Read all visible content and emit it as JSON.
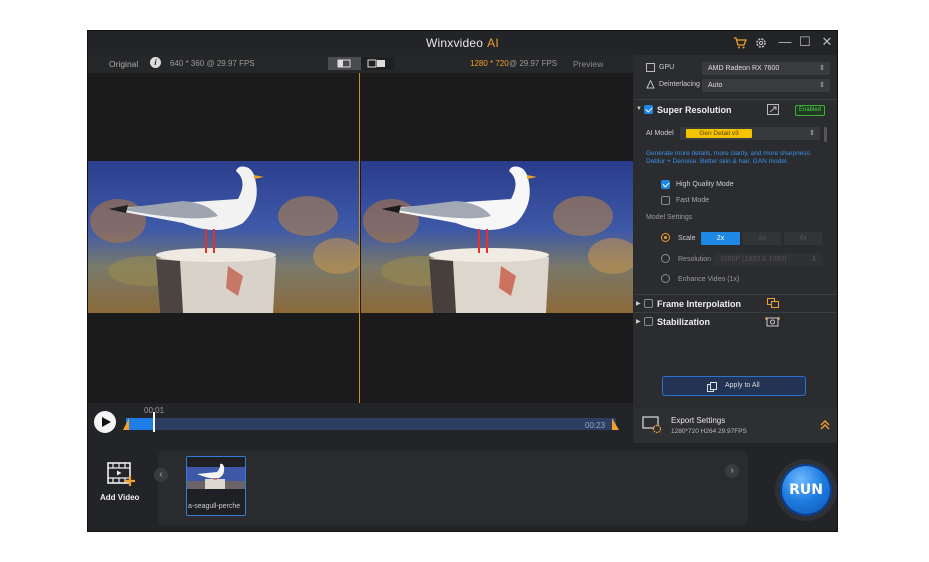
{
  "titlebar": {
    "app_name": "Winxvideo",
    "app_suffix": "AI",
    "icons": [
      "cart-icon",
      "gear-icon"
    ]
  },
  "info_bar": {
    "original_label": "Original",
    "original_info": "640 * 360 @ 29.97 FPS",
    "preview_res": "1280 * 720",
    "preview_fps": "@ 29.97 FPS",
    "preview_label": "Preview"
  },
  "timeline": {
    "current": "00:01",
    "end": "00:23",
    "progress": 0.06
  },
  "panel": {
    "gpu_label": "GPU",
    "gpu_value": "AMD Radeon RX 7600",
    "deinterlacing_label": "Deinterlacing",
    "deinterlacing_value": "Auto",
    "super_resolution": {
      "title": "Super Resolution",
      "badge": "Enabled",
      "ai_model_label": "AI Model",
      "ai_model_value": "Gen Detail v3",
      "description_1": "Generate more details, more clarity, and more sharpness.",
      "description_2": "Deblur + Denoise. Better skin & hair. GAN model.",
      "high_quality_mode": "High Quality Mode",
      "fast_mode": "Fast Mode",
      "model_settings_label": "Model Settings",
      "scale_label": "Scale",
      "scale_options": [
        "2x",
        "3x",
        "4x"
      ],
      "resolution_label": "Resolution",
      "resolution_value": "1080P (1920 X 1080)",
      "enhance_label": "Enhance Video (1x)"
    },
    "frame_interpolation": "Frame Interpolation",
    "stabilization": "Stabilization",
    "apply_all": "Apply to All"
  },
  "export": {
    "title": "Export Settings",
    "details": "1280*720  H264  29.97FPS"
  },
  "bottom": {
    "add_video": "Add Video",
    "thumb_label": "a-seagull-perche",
    "run_label": "RUN"
  },
  "colors": {
    "accent": "#f0a030",
    "blue": "#1e88e5",
    "enabled_badge": "#3fae3f",
    "model_select": "#f5c400"
  }
}
